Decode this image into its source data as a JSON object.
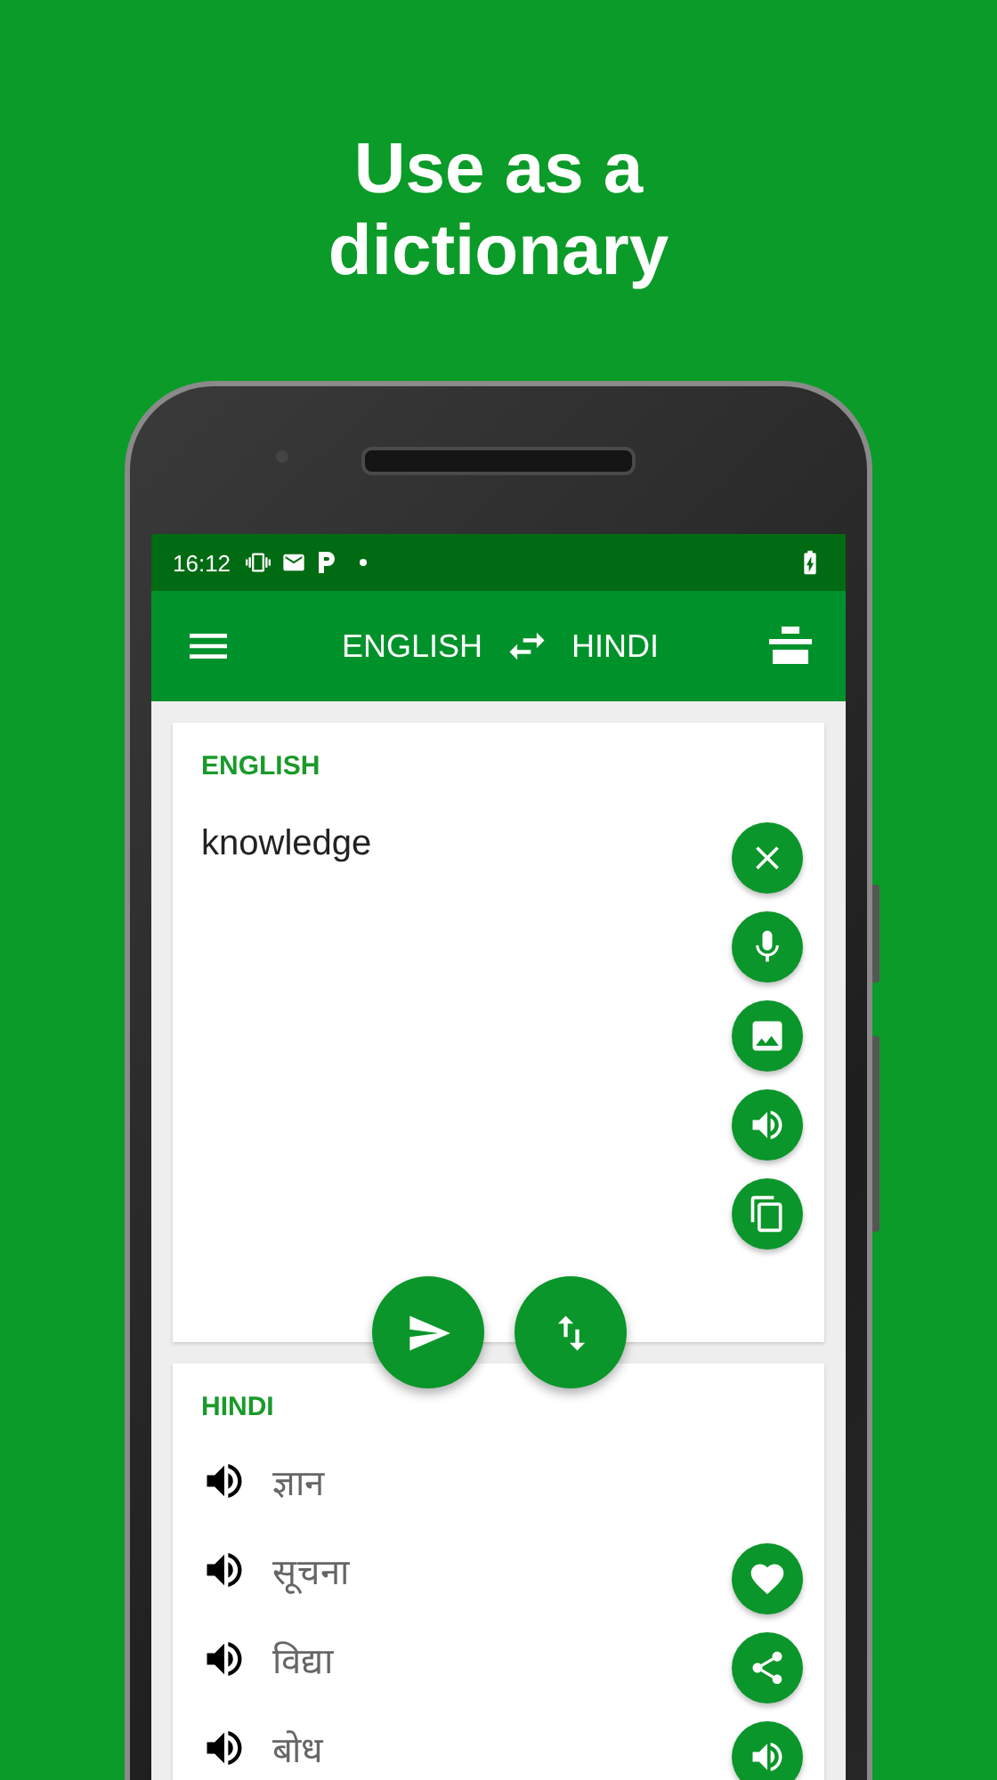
{
  "headline": "Use as a\ndictionary",
  "status_bar": {
    "time": "16:12"
  },
  "app_bar": {
    "source_language": "ENGLISH",
    "target_language": "HINDI"
  },
  "input_card": {
    "label": "ENGLISH",
    "value": "knowledge",
    "actions": [
      {
        "kind": "clear"
      },
      {
        "kind": "mic"
      },
      {
        "kind": "image"
      },
      {
        "kind": "speak"
      },
      {
        "kind": "copy"
      }
    ]
  },
  "fabs": [
    {
      "kind": "translate"
    },
    {
      "kind": "swap"
    }
  ],
  "result_card": {
    "label": "HINDI",
    "translations": [
      "ज्ञान",
      "सूचना",
      "विद्या",
      "बोध"
    ],
    "actions": [
      {
        "kind": "favorite"
      },
      {
        "kind": "share"
      },
      {
        "kind": "speak"
      }
    ]
  }
}
